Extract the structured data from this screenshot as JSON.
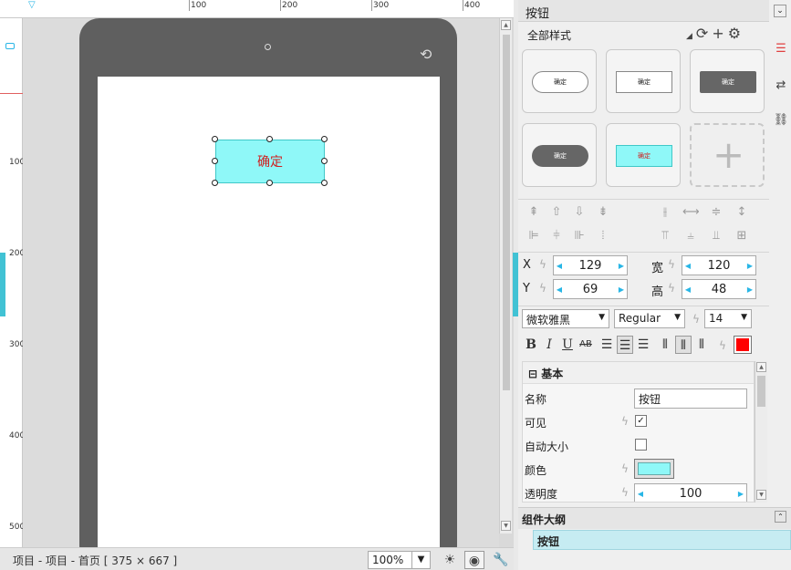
{
  "ruler": {
    "top_labels": [
      "100",
      "200",
      "300",
      "400"
    ],
    "left_labels": [
      "100",
      "200",
      "300",
      "400",
      "500"
    ]
  },
  "canvas": {
    "widget_label": "确定"
  },
  "status": {
    "text": "项目 - 项目 - 首页 [ 375 × 667 ]",
    "zoom": "100%"
  },
  "panel": {
    "title": "按钮",
    "styles_label": "全部样式",
    "style_previews": [
      "确定",
      "确定",
      "确定",
      "确定",
      "确定"
    ],
    "geometry": {
      "x_label": "X",
      "x_value": "129",
      "y_label": "Y",
      "y_value": "69",
      "w_label": "宽",
      "w_value": "120",
      "h_label": "高",
      "h_value": "48"
    },
    "font": {
      "family": "微软雅黑",
      "weight": "Regular",
      "size": "14"
    },
    "text_color": "#ff0000",
    "properties": {
      "section": "基本",
      "name_label": "名称",
      "name_value": "按钮",
      "visible_label": "可见",
      "visible_checked": "✓",
      "autosize_label": "自动大小",
      "color_label": "颜色",
      "fill_color": "#8ff8f8",
      "opacity_label": "透明度",
      "opacity_value": "100"
    },
    "outline": {
      "title": "组件大纲",
      "item": "按钮"
    }
  }
}
